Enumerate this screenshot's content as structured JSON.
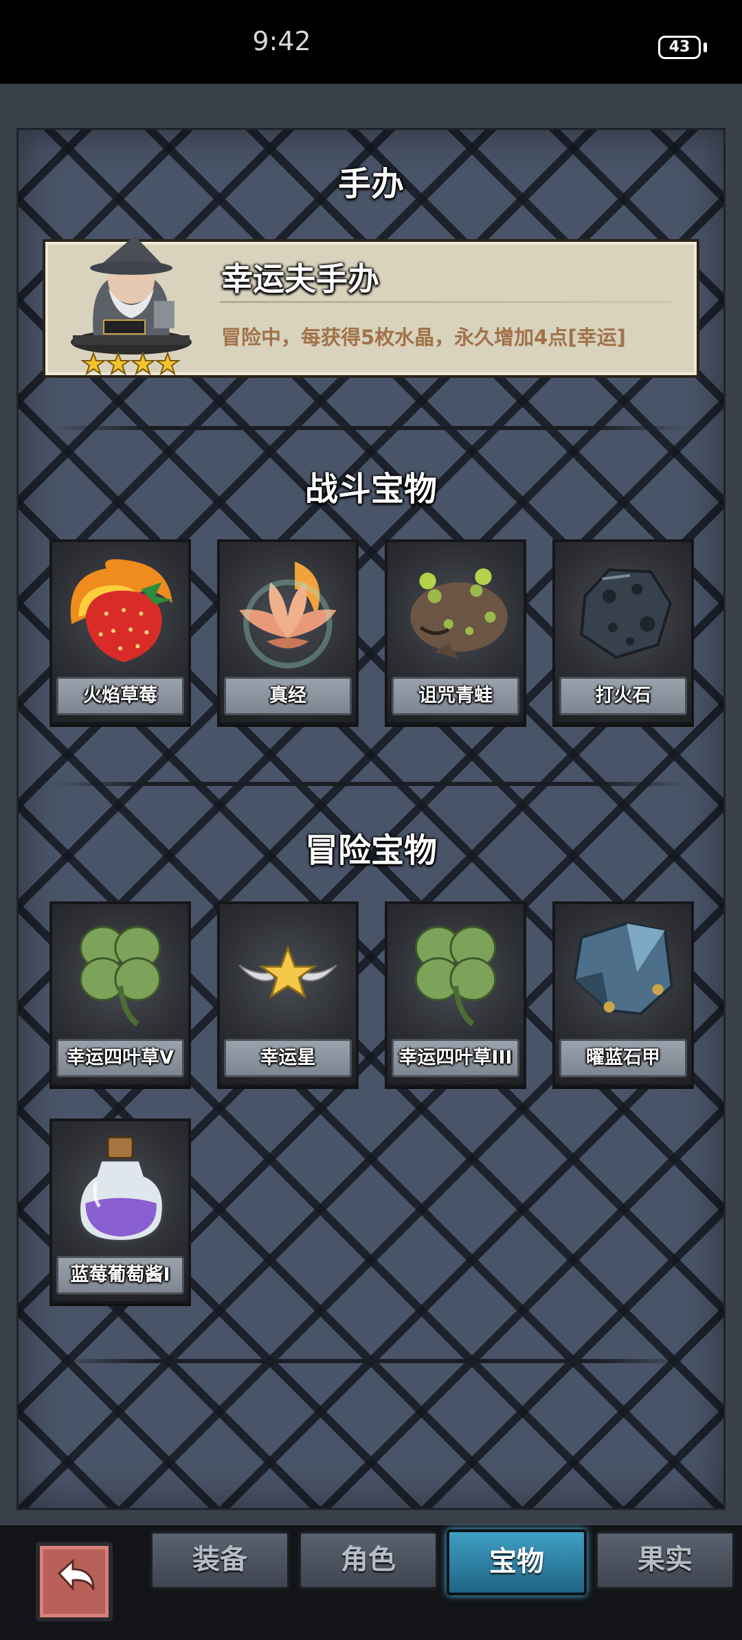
{
  "status_bar": {
    "time": "9:42",
    "battery": "43"
  },
  "page_title": "手办",
  "figure": {
    "name": "幸运夫手办",
    "description": "冒险中，每获得5枚水晶，永久增加4点[幸运]",
    "stars": 4
  },
  "battle_section": {
    "title": "战斗宝物",
    "items": [
      {
        "label": "火焰草莓",
        "icon": "flaming-strawberry-icon"
      },
      {
        "label": "真经",
        "icon": "flame-lotus-icon"
      },
      {
        "label": "诅咒青蛙",
        "icon": "cursed-frog-icon"
      },
      {
        "label": "打火石",
        "icon": "flint-stone-icon"
      }
    ]
  },
  "adventure_section": {
    "title": "冒险宝物",
    "items": [
      {
        "label": "幸运四叶草V",
        "icon": "four-leaf-clover-icon"
      },
      {
        "label": "幸运星",
        "icon": "winged-star-icon"
      },
      {
        "label": "幸运四叶草III",
        "icon": "four-leaf-clover-icon"
      },
      {
        "label": "曜蓝石甲",
        "icon": "blue-stone-armor-icon"
      },
      {
        "label": "蓝莓葡萄酱I",
        "icon": "purple-potion-bottle-icon"
      }
    ]
  },
  "bottom_nav": {
    "back_icon": "back-arrow-icon",
    "tabs": [
      {
        "label": "装备",
        "active": false
      },
      {
        "label": "角色",
        "active": false
      },
      {
        "label": "宝物",
        "active": true
      },
      {
        "label": "果实",
        "active": false
      }
    ]
  },
  "colors": {
    "accent_tab": "#2a86ad",
    "description_text": "#a0724a",
    "star": "#f4c32b"
  }
}
